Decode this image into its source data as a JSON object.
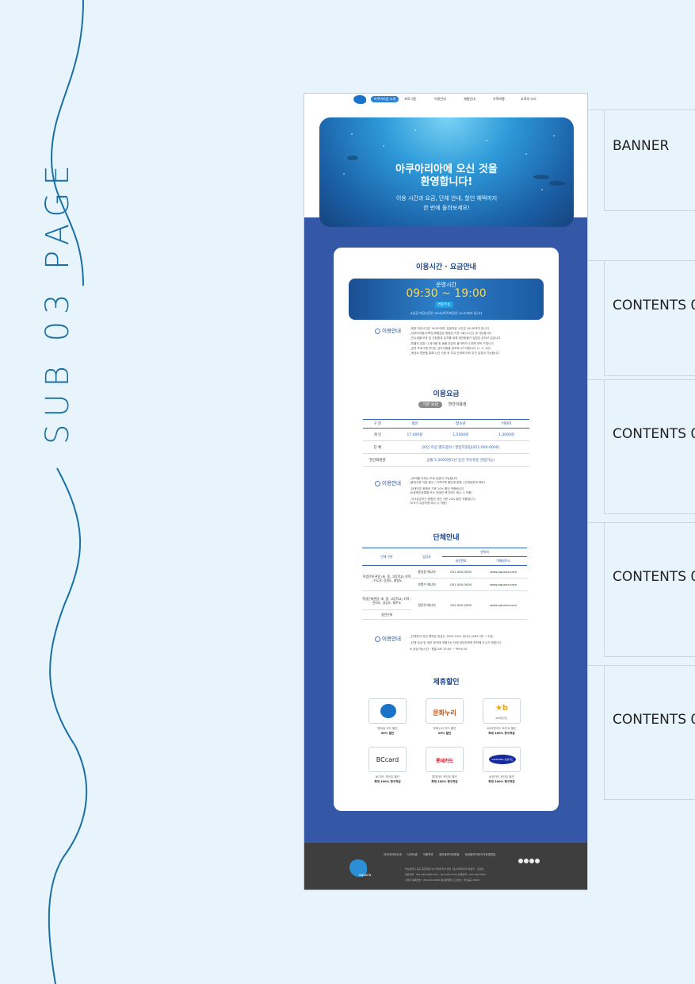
{
  "side_title": "SUB 03 PAGE",
  "labels": [
    "BANNER",
    "CONTENTS 0",
    "CONTENTS 0",
    "CONTENTS 0",
    "CONTENTS 0"
  ],
  "nav": {
    "items": [
      "아쿠아리움 소개",
      "프로그램",
      "이용안내",
      "체험안내",
      "가족여행",
      "고객의 소리"
    ],
    "active": 0
  },
  "banner": {
    "heading_line1": "아쿠아리아에 오신 것을",
    "heading_line2": "환영합니다!",
    "sub_line1": "이용 시간과 요금, 단체 안내, 할인 혜택까지",
    "sub_line2": "한 번에 둘러보세요!"
  },
  "hours_section": {
    "title": "이용시간 · 요금안내",
    "banner_label": "운영시간",
    "time": "09:30 ~ 19:00",
    "badge": "연중무휴",
    "note": "★입장 마감시간은 18:30이며 퇴장은 19:00까지 입니다",
    "info_label": "이용안내",
    "info_lines": [
      "_매표 마감시간은 18:00이며, 입장마감 시간은 18:30까지 입니다",
      "_아쿠아리움/수족관/체험존은 종합권 기준 1회(1시간) 내 가능합니다",
      "_전시생물 보호 및 관람환경 유지를 위해 재관람불가 입장은 금하고 있습니다",
      "_특별전 입장 시 음식물 및 동물 반입이 불가하오니 양해 부탁 드립니다",
      "_공연 프로그램 안내는 공지사항을 참조하시기 바랍니다 (1, 2, 3관)",
      "_매표소 방문을 통해 시간 신청 후 자유 안내에 따라 우선 입장이 가능합니다"
    ]
  },
  "fees_section": {
    "title": "이용요금",
    "tabs": [
      "기본 요금",
      "연간이용권"
    ],
    "headers": [
      "구 분",
      "성인",
      "청소년",
      "어린이"
    ],
    "rows": [
      {
        "label": "개 인",
        "adult": "17,000원",
        "youth": "1,5000원",
        "child": "1,3000원"
      },
      {
        "label": "단 체",
        "merged": "20인 이상 별도협의 / 영업지원팀(051-000-0000)"
      },
      {
        "label": "연간회원권",
        "merged": "공통 5,5000원(1년 동안 자유로운 관람가능)"
      }
    ],
    "info_label": "이용안내",
    "info_lines": [
      "_36개월 이하는 무료 입장이 가능합니다",
      "(증빙서류 지참 필수 / 지역가족 할인에 한함 / 단체입장객 제외)",
      "",
      "_장애인은 종합권 기준 20% 할인 적용됩니다",
      "(※장애인등록증 또는 장애인 복지카드 제시 시 적용)",
      "",
      "_국가유공자는 종합권 성인 기준 20% 할인 적용됩니다",
      "(※국가 유공자증 제시 시 적용)"
    ]
  },
  "group_section": {
    "title": "단체안내",
    "headers": [
      "단체 구분",
      "담당자",
      "연락처",
      "내선번호",
      "이메일주소"
    ],
    "rows": [
      {
        "group": "학생단체 관람 (초, 중, 고등학교) 지역 : 수도권, 강원도, 충청도",
        "manager": "홍길동 매니저",
        "phone": "051-000-0000",
        "email": "www.aquaria.com"
      },
      {
        "group": "",
        "manager": "박명수 매니저",
        "phone": "051-000-0000",
        "email": "www.aquaria.com"
      },
      {
        "group": "학생단체관람 (초, 중, 고등학교) 지역 : 전라도, 경상도, 제주도",
        "manager": "정준하 매니저",
        "phone": "051-000-0000",
        "email": "www.aquaria.com"
      },
      {
        "group": "일반단체",
        "manager": "",
        "phone": "",
        "email": ""
      }
    ],
    "info_label": "이용안내",
    "info_lines": [
      "_단체문의 전담 예약상 번호는 1833-1001 입니다 (ARS 5번 → 1번)",
      "_단체 요금 및 세부 문의에 대해서는 단체 담당자에게 문의해 주시기 바랍니다",
      "※ 상담가능시간 : 평일 AM 10:00 ~ PM 6:00"
    ]
  },
  "discount_section": {
    "title": "제휴할인",
    "partners": [
      {
        "logo": "aquaria",
        "name": "멤버쉽 카드 할인",
        "benefit": "30% 할인"
      },
      {
        "logo": "문화누리",
        "name": "문화누리 카드 할인",
        "benefit": "10% 할인"
      },
      {
        "logo": "KB국민카드",
        "name": "KB국민카드 포인트 할인",
        "benefit": "최대 100% 청구처감"
      },
      {
        "logo": "BCcard",
        "name": "BC카드 포인트 할인",
        "benefit": "최대 100% 청구처감"
      },
      {
        "logo": "롯데카드",
        "name": "롯데카드 포인트 할인",
        "benefit": "최대 100% 청구처감"
      },
      {
        "logo": "SAMSUNG 삼성카드",
        "name": "삼성카드 포인트 할인",
        "benefit": "최대 100% 청구처감"
      }
    ]
  },
  "footer": {
    "links": [
      "아쿠아리아소개",
      "사이트맵",
      "이용약관",
      "개인정보처리방침",
      "영상정보처리기기운영방침"
    ],
    "logo_text": "aquaria",
    "address_lines": [
      "부산광역시 중구 중앙대로 00 아쿠아리아 빌딩 1층 아쿠아리아 대표자 : 홍길동",
      "대표전화 : 051-000-0000  FAX : 051-000-0000  단체예약 : 051-000-0000",
      "사업자 등록번호 : 000-00-00000 통신판매업 신고번호 : 부산중구-0000"
    ]
  },
  "colors": {
    "accent": "#3457a6",
    "title_blue": "#1e4a8f",
    "side_text": "#1a6fa6",
    "bg": "#e8f4fb"
  }
}
